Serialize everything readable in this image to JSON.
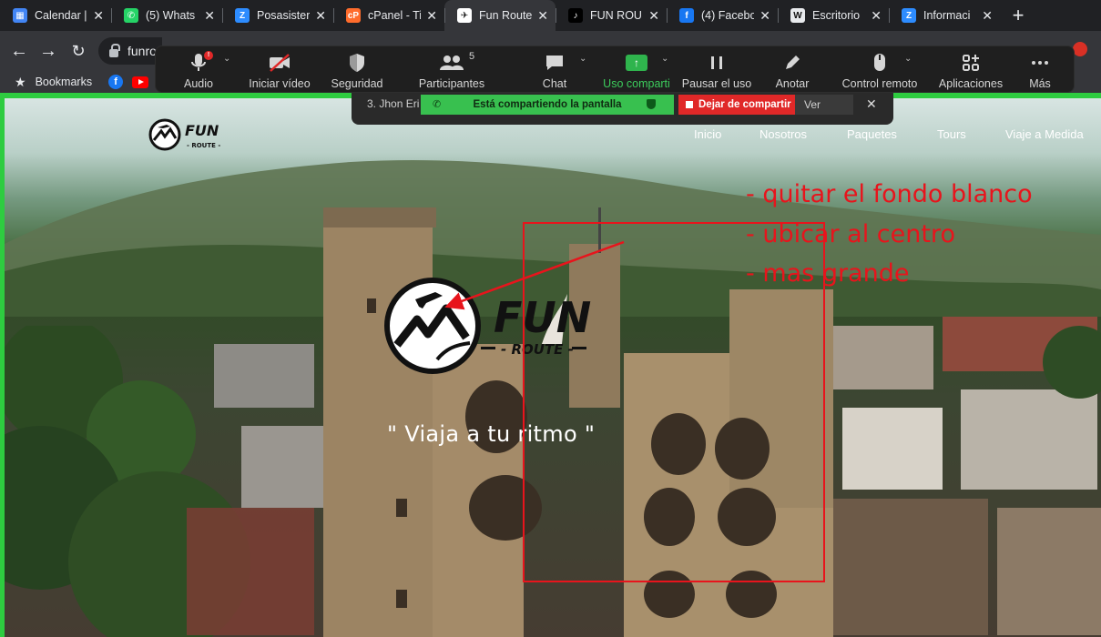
{
  "browser": {
    "tabs": [
      {
        "title": "Calendar |",
        "favicon": "calendar-icon",
        "color": "#4285f4",
        "glyph": "▦",
        "active": false
      },
      {
        "title": "(5) Whats",
        "favicon": "whatsapp-icon",
        "color": "#25d366",
        "glyph": "✆",
        "active": false
      },
      {
        "title": "Posasister",
        "favicon": "zoom-icon",
        "color": "#2d8cff",
        "glyph": "Z",
        "active": false
      },
      {
        "title": "cPanel - Ti",
        "favicon": "cpanel-icon",
        "color": "#ff6c2c",
        "glyph": "cP",
        "active": false
      },
      {
        "title": "Fun Route",
        "favicon": "funroute-icon",
        "color": "#ffffff",
        "glyph": "✈",
        "active": true
      },
      {
        "title": "FUN ROU",
        "favicon": "tiktok-icon",
        "color": "#000000",
        "glyph": "♪",
        "active": false
      },
      {
        "title": "(4) Facebo",
        "favicon": "facebook-icon",
        "color": "#1877f2",
        "glyph": "f",
        "active": false
      },
      {
        "title": "Escritorio",
        "favicon": "wordpress-icon",
        "color": "#e8eaed",
        "glyph": "W",
        "active": false
      },
      {
        "title": "Informaci",
        "favicon": "zoom-icon",
        "color": "#2d8cff",
        "glyph": "Z",
        "active": false
      }
    ],
    "url_fragment": "funro",
    "bookmarks_label": "Bookmarks"
  },
  "zoom": {
    "toolbar": [
      {
        "label": "Audio",
        "icon": "microphone-icon"
      },
      {
        "label": "Iniciar vídeo",
        "icon": "video-off-icon"
      },
      {
        "label": "Seguridad",
        "icon": "shield-icon"
      },
      {
        "label": "Participantes",
        "icon": "participants-icon",
        "count": "5"
      },
      {
        "label": "Chat",
        "icon": "chat-icon"
      },
      {
        "label": "Uso comparti",
        "icon": "share-screen-icon"
      },
      {
        "label": "Pausar el uso",
        "icon": "pause-icon"
      },
      {
        "label": "Anotar",
        "icon": "pencil-icon"
      },
      {
        "label": "Control remoto",
        "icon": "mouse-icon"
      },
      {
        "label": "Aplicaciones",
        "icon": "apps-icon"
      },
      {
        "label": "Más",
        "icon": "more-icon"
      }
    ],
    "share_bar": {
      "participant": "3. Jhon Eri",
      "sharing_status": "Está compartiendo la pantalla",
      "stop_label": "Dejar de compartir",
      "view_label": "Ver"
    },
    "share_border_color": "#2ecc40"
  },
  "site": {
    "nav": [
      "Inicio",
      "Nosotros",
      "Paquetes",
      "Tours",
      "Viaje a Medida"
    ],
    "logo_text": "FUN",
    "logo_subtext": "- ROUTE -",
    "tagline": "\" Viaja a tu ritmo \""
  },
  "annotations": {
    "color": "#e8141c",
    "lines": [
      "- quitar el fondo blanco",
      "- ubicar al centro",
      "- mas grande"
    ]
  }
}
